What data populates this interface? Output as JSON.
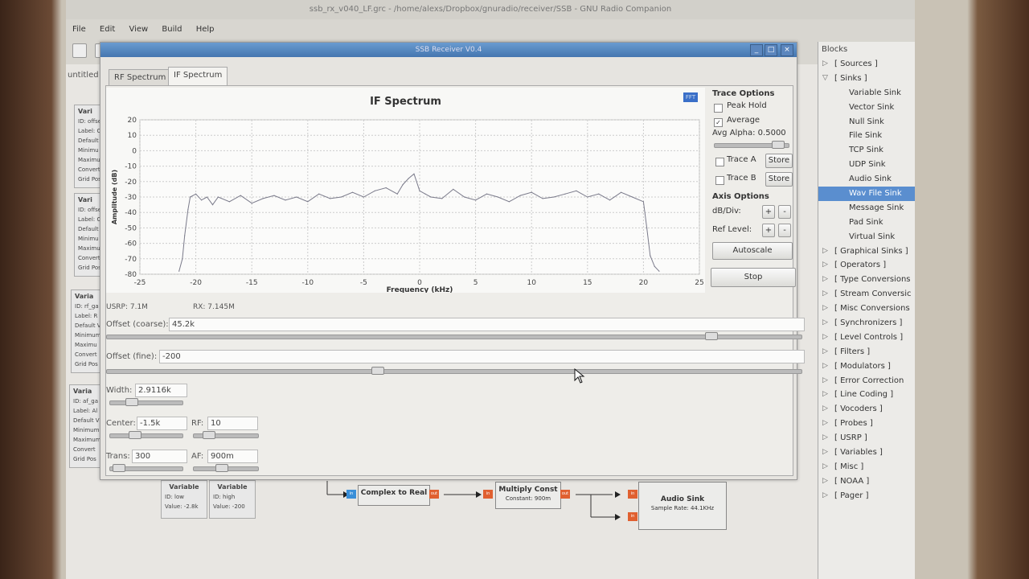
{
  "grc": {
    "title": "ssb_rx_v040_LF.grc - /home/alexs/Dropbox/gnuradio/receiver/SSB - GNU Radio Companion",
    "menu": [
      "File",
      "Edit",
      "View",
      "Build",
      "Help"
    ],
    "canvas_tab": "untitled"
  },
  "ssb_window": {
    "title": "SSB Receiver V0.4",
    "tabs": [
      "RF Spectrum",
      "IF Spectrum"
    ],
    "active_tab": "IF Spectrum"
  },
  "chart_data": {
    "type": "line",
    "title": "IF Spectrum",
    "xlabel": "Frequency (kHz)",
    "ylabel": "Amplitude (dB)",
    "xlim": [
      -25,
      25
    ],
    "ylim": [
      -80,
      20
    ],
    "x_ticks": [
      "-25",
      "-20",
      "-15",
      "-10",
      "-5",
      "0",
      "5",
      "10",
      "15",
      "20",
      "25"
    ],
    "y_ticks": [
      "20",
      "10",
      "0",
      "-10",
      "-20",
      "-30",
      "-40",
      "-50",
      "-60",
      "-70",
      "-80"
    ],
    "grid": true,
    "series": [
      {
        "color": "#7a7a8a",
        "x": [
          -21.5,
          -21.2,
          -21.0,
          -20.7,
          -20.5,
          -20.0,
          -19.5,
          -19.0,
          -18.5,
          -18.0,
          -17.0,
          -16.0,
          -15.0,
          -14.0,
          -13.0,
          -12.0,
          -11.0,
          -10.0,
          -9.0,
          -8.0,
          -7.0,
          -6.0,
          -5.0,
          -4.0,
          -3.0,
          -2.0,
          -1.5,
          -1.0,
          -0.5,
          0.0,
          0.5,
          1.0,
          2.0,
          3.0,
          4.0,
          5.0,
          6.0,
          7.0,
          8.0,
          9.0,
          10.0,
          11.0,
          12.0,
          13.0,
          14.0,
          15.0,
          16.0,
          17.0,
          18.0,
          19.0,
          20.0,
          20.3,
          20.6,
          21.0,
          21.4
        ],
        "y": [
          -78,
          -70,
          -55,
          -38,
          -30,
          -28,
          -32,
          -30,
          -35,
          -30,
          -33,
          -29,
          -34,
          -31,
          -29,
          -32,
          -30,
          -33,
          -28,
          -31,
          -30,
          -27,
          -30,
          -26,
          -24,
          -28,
          -22,
          -18,
          -15,
          -26,
          -28,
          -30,
          -31,
          -25,
          -30,
          -32,
          -28,
          -30,
          -33,
          -29,
          -27,
          -31,
          -30,
          -28,
          -26,
          -30,
          -28,
          -32,
          -27,
          -30,
          -33,
          -50,
          -68,
          -75,
          -78
        ]
      }
    ]
  },
  "trace_options": {
    "header": "Trace Options",
    "peak_hold": "Peak Hold",
    "average": "Average",
    "avg_alpha": "Avg Alpha: 0.5000",
    "trace_a": "Trace A",
    "trace_b": "Trace B",
    "store": "Store",
    "peak_hold_checked": false,
    "average_checked": true
  },
  "axis_options": {
    "header": "Axis Options",
    "db_div": "dB/Div:",
    "ref_level": "Ref Level:",
    "plus": "+",
    "minus": "-",
    "autoscale": "Autoscale",
    "stop": "Stop"
  },
  "status": {
    "usrp": "USRP: 7.1M",
    "rx": "RX: 7.145M"
  },
  "controls": {
    "offset_coarse_label": "Offset (coarse):",
    "offset_coarse_value": "45.2k",
    "offset_coarse_level": 0.87,
    "offset_fine_label": "Offset (fine):",
    "offset_fine_value": "-200",
    "offset_fine_level": 0.39,
    "width_label": "Width:",
    "width_value": "2.9116k",
    "center_label": "Center:",
    "center_value": "-1.5k",
    "rf_label": "RF:",
    "rf_value": "10",
    "trans_label": "Trans:",
    "trans_value": "300",
    "af_label": "AF:",
    "af_value": "900m"
  },
  "flowgraph": {
    "var_low": {
      "title": "Variable",
      "id": "ID: low",
      "value": "Value: -2.8k"
    },
    "var_high": {
      "title": "Variable",
      "id": "ID: high",
      "value": "Value: -200"
    },
    "complex_to_real": {
      "title": "Complex to Real"
    },
    "multiply_const": {
      "title": "Multiply Const",
      "param": "Constant: 900m"
    },
    "audio_sink": {
      "title": "Audio Sink",
      "param": "Sample Rate: 44.1KHz"
    },
    "port_in": "in",
    "port_out": "out"
  },
  "left_var_blocks": [
    {
      "title": "Vari",
      "lines": [
        "ID: offse",
        "Label: C",
        "Default",
        "Minimu",
        "Maximu",
        "Convert",
        "Grid Pos"
      ]
    },
    {
      "title": "Vari",
      "lines": [
        "ID: offse",
        "Label: O",
        "Default",
        "Minimu",
        "Maximu",
        "Convert",
        "Grid Pos"
      ]
    },
    {
      "title": "Varia",
      "lines": [
        "ID: rf_ga",
        "Label: R",
        "Default V",
        "Minimum",
        "Maximu",
        "Convert",
        "Grid Pos"
      ]
    },
    {
      "title": "Varia",
      "lines": [
        "ID: af_ga",
        "Label: Al",
        "Default V",
        "Minimum",
        "Maximum",
        "Convert",
        "Grid Pos"
      ]
    }
  ],
  "blocks_panel": {
    "header": "Blocks",
    "items": [
      {
        "label": "[ Sources ]",
        "kind": "cat",
        "expanded": false
      },
      {
        "label": "[ Sinks ]",
        "kind": "cat",
        "expanded": true
      },
      {
        "label": "Variable Sink",
        "kind": "sub"
      },
      {
        "label": "Vector Sink",
        "kind": "sub"
      },
      {
        "label": "Null Sink",
        "kind": "sub"
      },
      {
        "label": "File Sink",
        "kind": "sub"
      },
      {
        "label": "TCP Sink",
        "kind": "sub"
      },
      {
        "label": "UDP Sink",
        "kind": "sub"
      },
      {
        "label": "Audio Sink",
        "kind": "sub"
      },
      {
        "label": "Wav File Sink",
        "kind": "sub",
        "selected": true
      },
      {
        "label": "Message Sink",
        "kind": "sub"
      },
      {
        "label": "Pad Sink",
        "kind": "sub"
      },
      {
        "label": "Virtual Sink",
        "kind": "sub"
      },
      {
        "label": "[ Graphical Sinks ]",
        "kind": "cat"
      },
      {
        "label": "[ Operators ]",
        "kind": "cat"
      },
      {
        "label": "[ Type Conversions",
        "kind": "cat"
      },
      {
        "label": "[ Stream Conversic",
        "kind": "cat"
      },
      {
        "label": "[ Misc Conversions",
        "kind": "cat"
      },
      {
        "label": "[ Synchronizers ]",
        "kind": "cat"
      },
      {
        "label": "[ Level Controls ]",
        "kind": "cat"
      },
      {
        "label": "[ Filters ]",
        "kind": "cat"
      },
      {
        "label": "[ Modulators ]",
        "kind": "cat"
      },
      {
        "label": "[ Error Correction",
        "kind": "cat"
      },
      {
        "label": "[ Line Coding ]",
        "kind": "cat"
      },
      {
        "label": "[ Vocoders ]",
        "kind": "cat"
      },
      {
        "label": "[ Probes ]",
        "kind": "cat"
      },
      {
        "label": "[ USRP ]",
        "kind": "cat"
      },
      {
        "label": "[ Variables ]",
        "kind": "cat"
      },
      {
        "label": "[ Misc ]",
        "kind": "cat"
      },
      {
        "label": "[ NOAA ]",
        "kind": "cat"
      },
      {
        "label": "[ Pager ]",
        "kind": "cat"
      }
    ]
  }
}
